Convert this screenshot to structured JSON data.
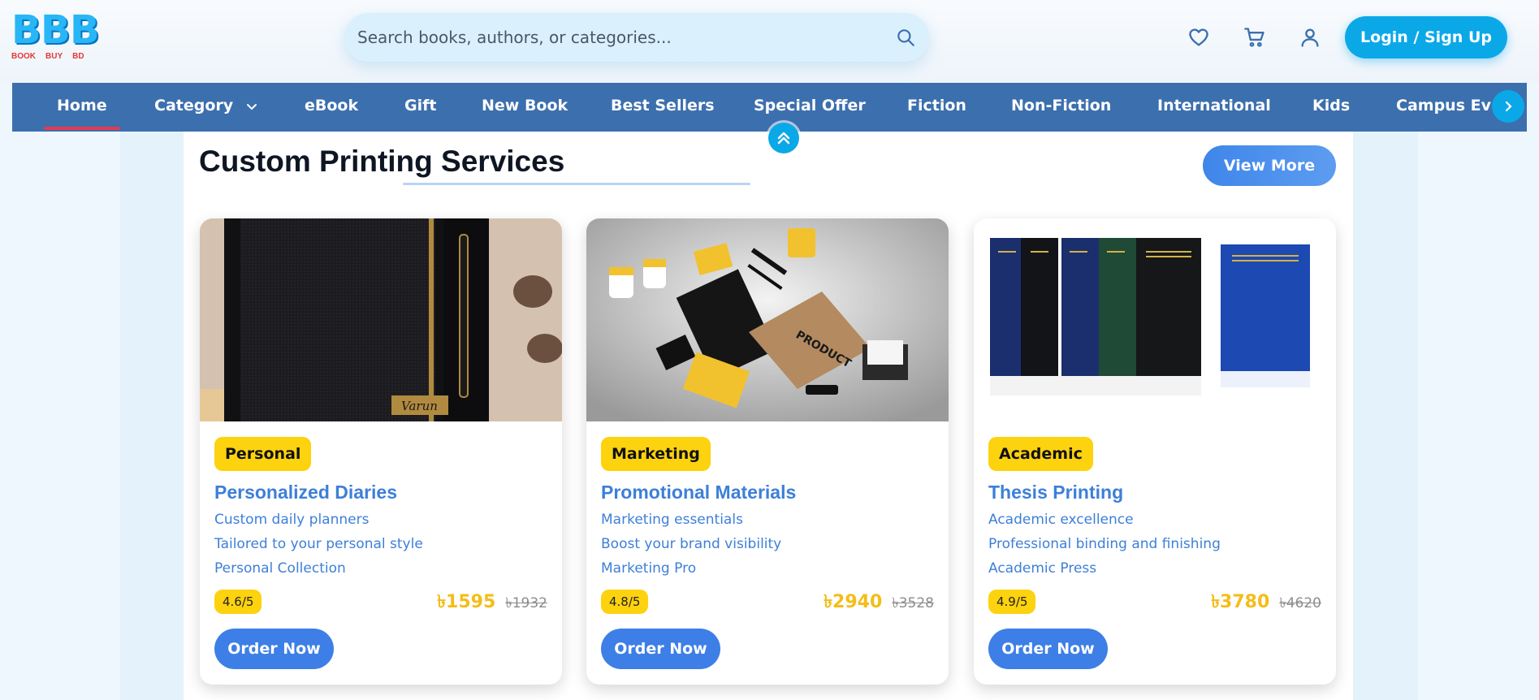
{
  "brand": {
    "letters": [
      "B",
      "B",
      "B"
    ],
    "words": [
      "BOOK",
      "BUY",
      "BD"
    ]
  },
  "search": {
    "placeholder": "Search books, authors, or categories..."
  },
  "header": {
    "login_label": "Login / Sign Up"
  },
  "icons": {
    "search": "search-icon",
    "wishlist": "heart-icon",
    "cart": "cart-icon",
    "account": "user-icon",
    "next": "chevron-right-icon",
    "scroll_top": "double-chevron-up-icon"
  },
  "nav": {
    "items": [
      {
        "label": "Home",
        "active": true
      },
      {
        "label": "Category",
        "has_dropdown": true
      },
      {
        "label": "eBook"
      },
      {
        "label": "Gift"
      },
      {
        "label": "New Book"
      },
      {
        "label": "Best Sellers"
      },
      {
        "label": "Special Offer"
      },
      {
        "label": "Fiction"
      },
      {
        "label": "Non-Fiction"
      },
      {
        "label": "International"
      },
      {
        "label": "Kids"
      },
      {
        "label": "Campus Ev"
      }
    ]
  },
  "section": {
    "title": "Custom Printing Services",
    "view_more_label": "View More"
  },
  "colors": {
    "accent": "#0ba8e8",
    "nav_bg": "#3c6fae",
    "badge": "#fdd20e",
    "link_blue": "#3d7fd9",
    "price": "#f4bd18"
  },
  "cards": [
    {
      "image_subject": "black diary with engraved name plate",
      "image_text": "Varun",
      "badge": "Personal",
      "title": "Personalized Diaries",
      "lines": [
        "Custom daily planners",
        "Tailored to your personal style",
        "Personal Collection"
      ],
      "rating": "4.6/5",
      "price": "৳1595",
      "old_price": "৳1932",
      "order_label": "Order Now"
    },
    {
      "image_subject": "branded stationery mockup set",
      "image_text": "PRODUCT",
      "badge": "Marketing",
      "title": "Promotional Materials",
      "lines": [
        "Marketing essentials",
        "Boost your brand visibility",
        "Marketing Pro"
      ],
      "rating": "4.8/5",
      "price": "৳2940",
      "old_price": "৳3528",
      "order_label": "Order Now"
    },
    {
      "image_subject": "hardbound thesis books",
      "badge": "Academic",
      "title": "Thesis Printing",
      "lines": [
        "Academic excellence",
        "Professional binding and finishing",
        "Academic Press"
      ],
      "rating": "4.9/5",
      "price": "৳3780",
      "old_price": "৳4620",
      "order_label": "Order Now"
    }
  ]
}
